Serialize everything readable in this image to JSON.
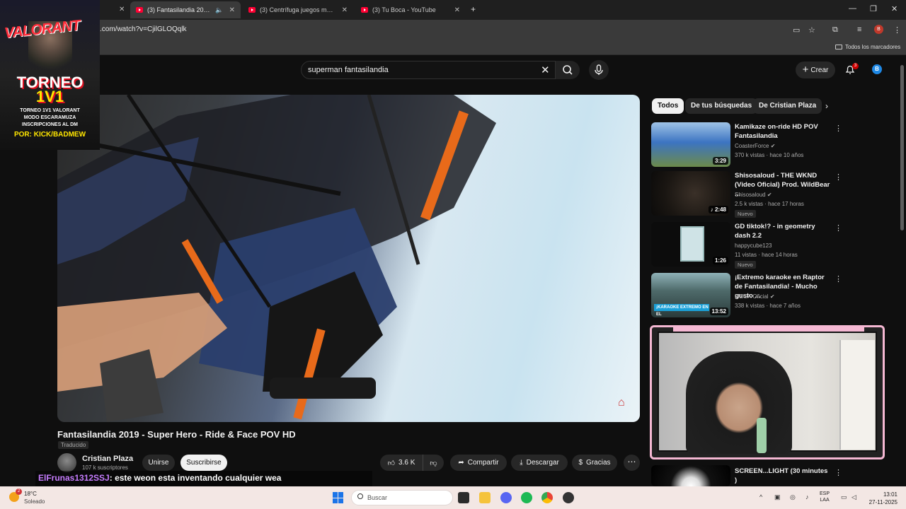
{
  "browser": {
    "tabs": [
      {
        "title": "(3) Fantasilandia 2019 - Sup",
        "active": true
      },
      {
        "title": "(3) Centrífuga juegos mecánico",
        "active": false
      },
      {
        "title": "(3) Tu Boca - YouTube",
        "active": false
      }
    ],
    "new_tab": "+",
    "url": ".com/watch?v=CjilGLOQqlk",
    "bookmarks_label": "Todos los marcadores",
    "profile_initial": "B"
  },
  "youtube": {
    "search_value": "superman fantasilandia",
    "create_label": "Crear",
    "notification_count": "3",
    "account_initial": "B",
    "video": {
      "title": "Fantasilandia 2019 - Super Hero - Ride & Face POV HD",
      "translated_label": "Traducido",
      "channel": "Cristian Plaza",
      "subscribers": "107 k suscriptores",
      "join_label": "Unirse",
      "subscribe_label": "Suscribirse",
      "likes": "3.6 K",
      "share_label": "Compartir",
      "download_label": "Descargar",
      "thanks_label": "Gracias"
    },
    "chips": [
      "Todos",
      "De tus búsquedas",
      "De Cristian Plaza"
    ],
    "recommendations": [
      {
        "title": "Kamikaze on-ride HD POV Fantasilandia",
        "channel": "CoasterForce",
        "meta": "370 k vistas · hace 10 años",
        "duration": "3:29",
        "badge": ""
      },
      {
        "title": "Shisosaloud - THE WKND (Video Oficial) Prod. WildBear ...",
        "channel": "Shisosaloud",
        "meta": "2.5 k vistas · hace 17 horas",
        "duration": "2:48",
        "badge": "Nuevo"
      },
      {
        "title": "GD tiktok!? - in geometry dash 2.2",
        "channel": "happycube123",
        "meta": "11 vistas · hace 14 horas",
        "duration": "1:26",
        "badge": "Nuevo"
      },
      {
        "title": "¡Extremo karaoke en Raptor de Fantasilandia! - Mucho gusto ...",
        "channel": "MEGA Oficial",
        "meta": "338 k vistas · hace 7 años",
        "duration": "13:52",
        "badge": ""
      },
      {
        "title": "SCREEN...LIGHT (30 minutes )",
        "channel": "",
        "meta": "",
        "duration": "",
        "badge": ""
      }
    ]
  },
  "overlay": {
    "poster": {
      "game": "VALORANT",
      "line1": "TORNEO",
      "line2": "1V1",
      "line3": "TORNEO 1V1 VALORANT",
      "line4": "MODO ESCARAMUZA",
      "line5": "INSCRIPCIONES AL DM",
      "line6": "POR: KICK/BADMEW"
    },
    "chat": {
      "user": "ElFrunas1312SSJ",
      "message": ": este weon esta inventando cualquier wea"
    }
  },
  "taskbar": {
    "temperature": "18°C",
    "weather": "Soleado",
    "weather_badge": "2",
    "search_placeholder": "Buscar",
    "lang_top": "ESP",
    "lang_bottom": "LAA",
    "time": "13:01",
    "date": "27-11-2025"
  }
}
